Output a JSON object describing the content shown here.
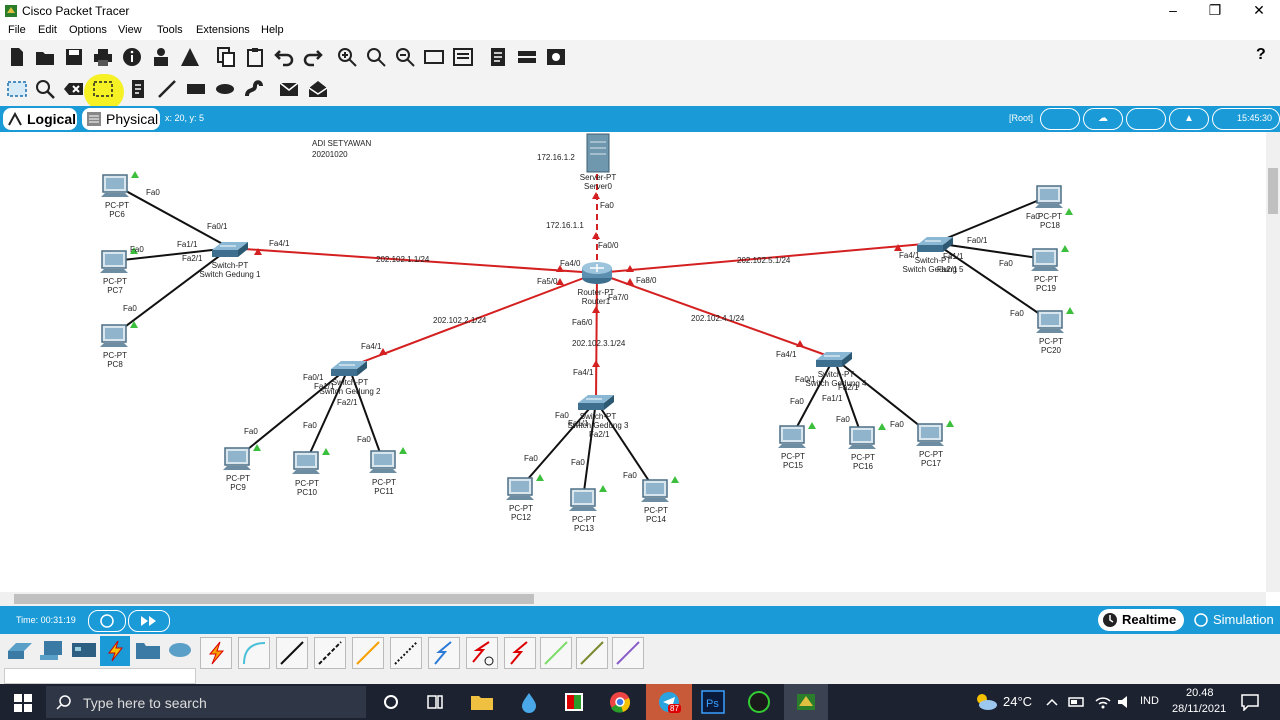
{
  "app": {
    "title": "Cisco Packet Tracer"
  },
  "menu": [
    "File",
    "Edit",
    "Options",
    "View",
    "Tools",
    "Extensions",
    "Help"
  ],
  "modes": {
    "logical": "Logical",
    "physical": "Physical",
    "coords": "x: 20, y: 5",
    "root": "[Root]",
    "clock": "15:45:30"
  },
  "annotation": {
    "name": "ADI SETYAWAN",
    "id": "20201020"
  },
  "bottom": {
    "time": "Time: 00:31:19",
    "realtime": "Realtime",
    "simulation": "Simulation"
  },
  "taskbar": {
    "search_placeholder": "Type here to search",
    "weather": "24°C",
    "lang": "IND",
    "time": "20.48",
    "date": "28/11/2021",
    "badge": "87"
  },
  "nodes": {
    "server": {
      "type": "Server-PT",
      "name": "Server0",
      "ip": "172.16.1.2"
    },
    "router": {
      "type": "Router-PT",
      "name": "Router1"
    },
    "sw1": {
      "type": "Switch-PT",
      "name": "Switch Gedung 1"
    },
    "sw2": {
      "type": "Switch-PT",
      "name": "Switch Gedung 2"
    },
    "sw3": {
      "type": "Switch-PT",
      "name": "Switch Gedung 3"
    },
    "sw4": {
      "type": "Switch-PT",
      "name": "Switch Gedung 4"
    },
    "sw5": {
      "type": "Switch-PT",
      "name": "Switch Gedung 5"
    },
    "pc6": {
      "type": "PC-PT",
      "name": "PC6"
    },
    "pc7": {
      "type": "PC-PT",
      "name": "PC7"
    },
    "pc8": {
      "type": "PC-PT",
      "name": "PC8"
    },
    "pc9": {
      "type": "PC-PT",
      "name": "PC9"
    },
    "pc10": {
      "type": "PC-PT",
      "name": "PC10"
    },
    "pc11": {
      "type": "PC-PT",
      "name": "PC11"
    },
    "pc12": {
      "type": "PC-PT",
      "name": "PC12"
    },
    "pc13": {
      "type": "PC-PT",
      "name": "PC13"
    },
    "pc14": {
      "type": "PC-PT",
      "name": "PC14"
    },
    "pc15": {
      "type": "PC-PT",
      "name": "PC15"
    },
    "pc16": {
      "type": "PC-PT",
      "name": "PC16"
    },
    "pc17": {
      "type": "PC-PT",
      "name": "PC17"
    },
    "pc18": {
      "type": "PC-PT",
      "name": "PC18"
    },
    "pc19": {
      "type": "PC-PT",
      "name": "PC19"
    },
    "pc20": {
      "type": "PC-PT",
      "name": "PC20"
    }
  },
  "links": {
    "server_router": "172.16.1.1",
    "router_sw1": "202.102.1.1/24",
    "router_sw2": "202.102.2.1/24",
    "router_sw3": "202.102.3.1/24",
    "router_sw4": "202.102.4.1/24",
    "router_sw5": "202.102.5.1/24"
  },
  "ports": {
    "fa0": "Fa0",
    "fa0_0": "Fa0/0",
    "fa0_1": "Fa0/1",
    "fa1_1": "Fa1/1",
    "fa2_1": "Fa2/1",
    "fa4_1": "Fa4/1",
    "fa4_0": "Fa4/0",
    "fa5_0": "Fa5/0",
    "fa6_0": "Fa6/0",
    "fa7_0": "Fa7/0",
    "fa8_0": "Fa8/0"
  },
  "colors": {
    "accent": "#1a9bd7",
    "link_red": "#d42020",
    "link_black": "#111111",
    "taskbar": "#1c2230"
  }
}
